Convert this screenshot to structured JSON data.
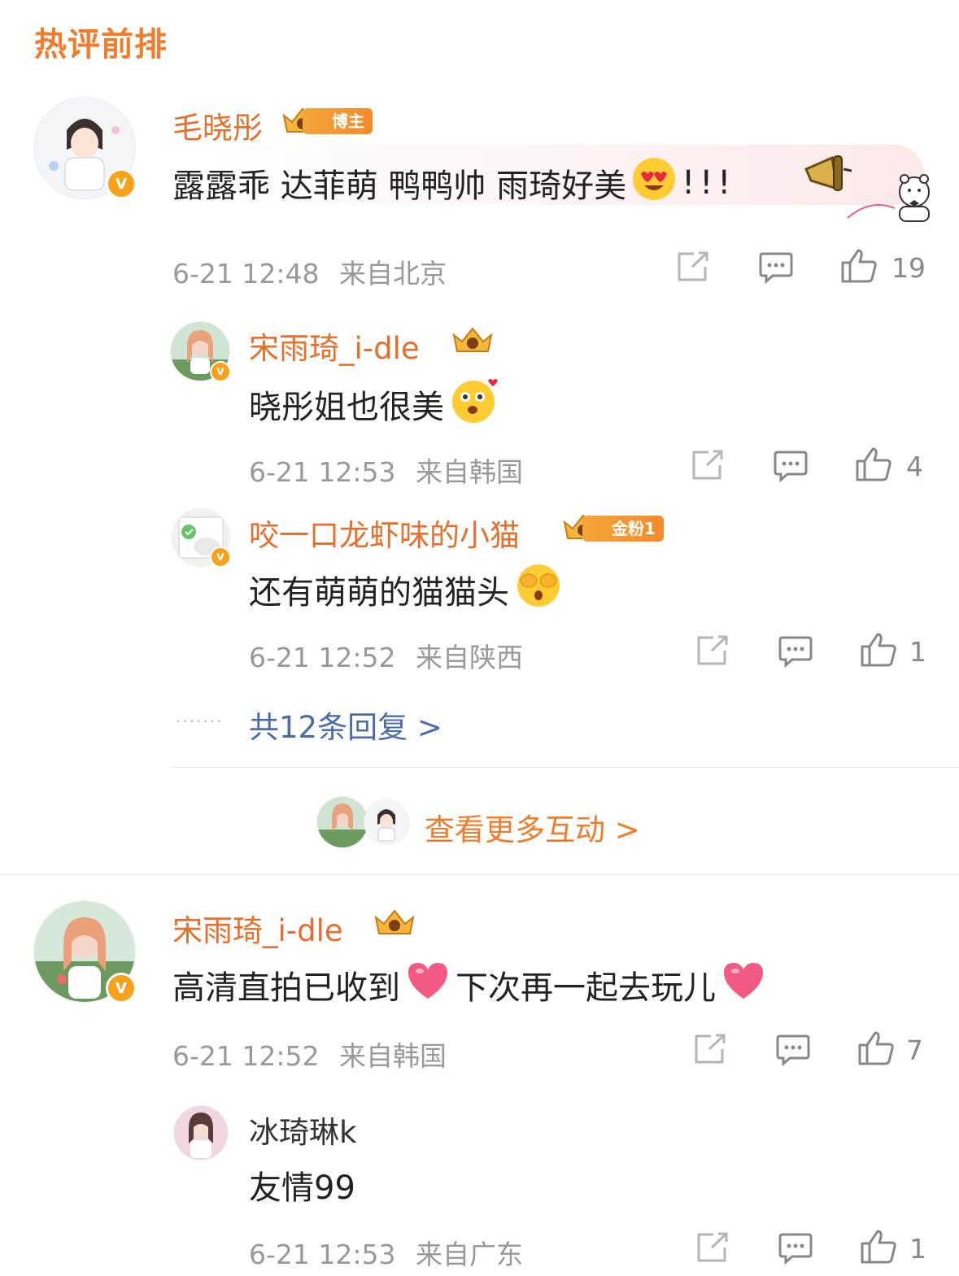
{
  "header": {
    "title": "热评前排"
  },
  "comments": [
    {
      "name": "毛晓彤",
      "tag": "博主",
      "text": "露露乖 达菲萌 鸭鸭帅 雨琦好美",
      "suffix": "!!!",
      "time": "6-21 12:48",
      "location": "来自北京",
      "likes": "19"
    },
    {
      "name": "宋雨琦_i-dle",
      "text": "晓彤姐也很美",
      "time": "6-21 12:53",
      "location": "来自韩国",
      "likes": "4"
    },
    {
      "name": "咬一口龙虾味的小猫",
      "tag": "金粉1",
      "text": "还有萌萌的猫猫头",
      "time": "6-21 12:52",
      "location": "来自陕西",
      "likes": "1"
    },
    {
      "name": "宋雨琦_i-dle",
      "text_a": "高清直拍已收到",
      "text_b": "下次再一起去玩儿",
      "time": "6-21 12:52",
      "location": "来自韩国",
      "likes": "7"
    },
    {
      "name": "冰琦琳k",
      "text": "友情99",
      "time": "6-21 12:53",
      "location": "来自广东",
      "likes": "1"
    }
  ],
  "replies_link": "共12条回复 >",
  "interactions_link": "查看更多互动 >",
  "icons": {
    "share": "share-icon",
    "comment": "comment-icon",
    "like": "thumbs-up-icon"
  },
  "colors": {
    "accent": "#e86e2b",
    "link": "#4a6ca8",
    "meta": "#999999"
  }
}
